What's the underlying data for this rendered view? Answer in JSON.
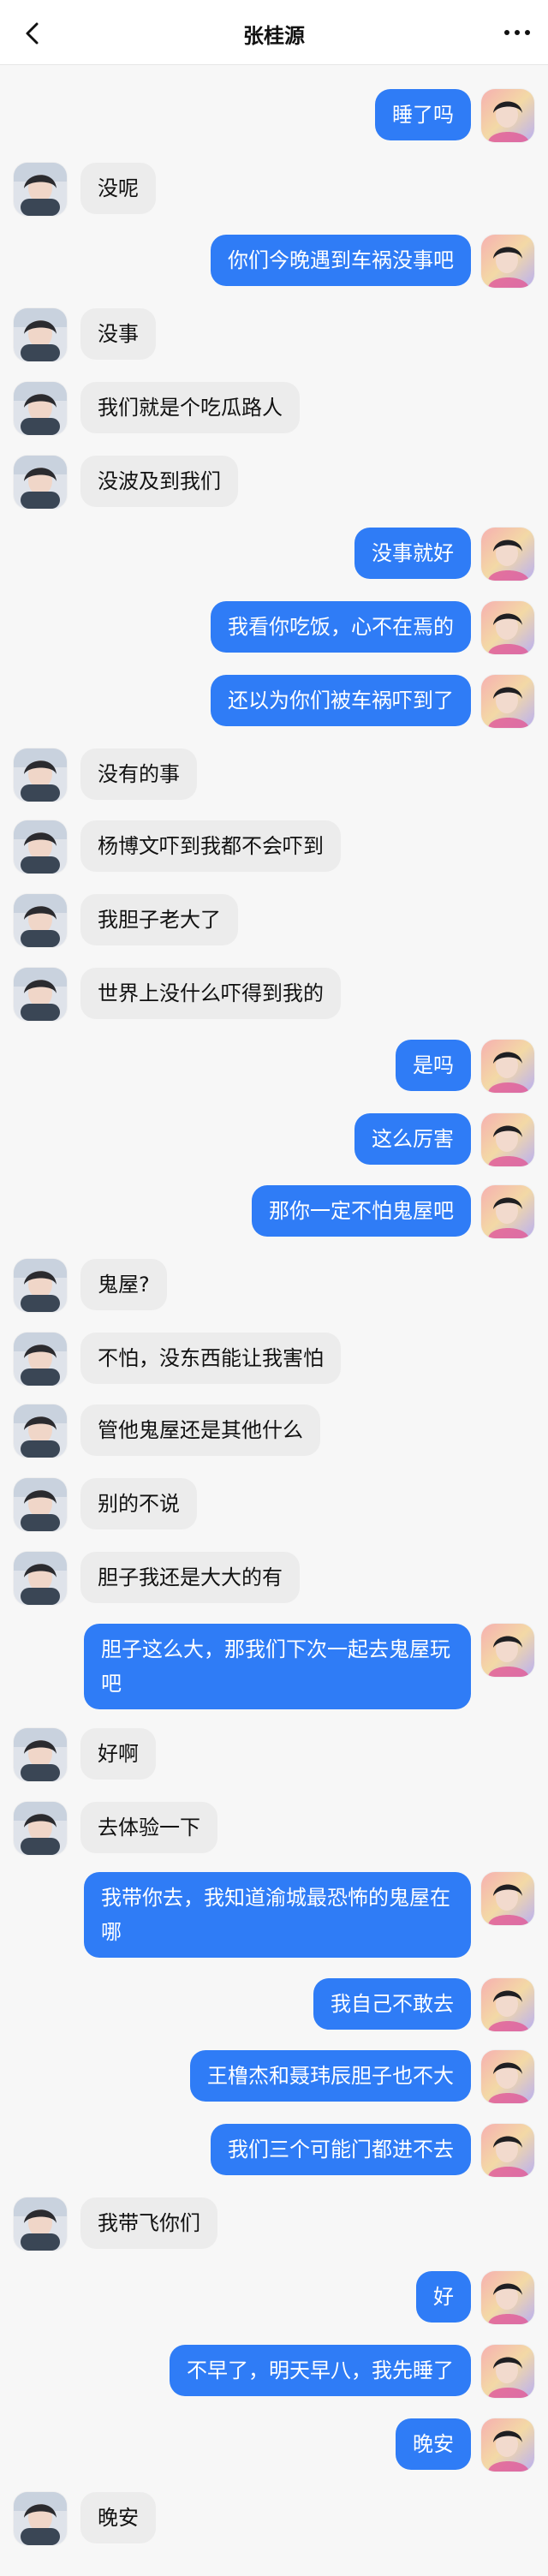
{
  "header": {
    "title": "张桂源"
  },
  "colors": {
    "sent_bubble": "#2f7cf6",
    "received_bubble": "#ececec",
    "background": "#f7f7f7"
  },
  "messages": [
    {
      "side": "right",
      "text": "睡了吗"
    },
    {
      "side": "left",
      "text": "没呢"
    },
    {
      "side": "right",
      "text": "你们今晚遇到车祸没事吧"
    },
    {
      "side": "left",
      "text": "没事"
    },
    {
      "side": "left",
      "text": "我们就是个吃瓜路人"
    },
    {
      "side": "left",
      "text": "没波及到我们"
    },
    {
      "side": "right",
      "text": "没事就好"
    },
    {
      "side": "right",
      "text": "我看你吃饭，心不在焉的"
    },
    {
      "side": "right",
      "text": "还以为你们被车祸吓到了"
    },
    {
      "side": "left",
      "text": "没有的事"
    },
    {
      "side": "left",
      "text": "杨博文吓到我都不会吓到"
    },
    {
      "side": "left",
      "text": "我胆子老大了"
    },
    {
      "side": "left",
      "text": "世界上没什么吓得到我的"
    },
    {
      "side": "right",
      "text": "是吗"
    },
    {
      "side": "right",
      "text": "这么厉害"
    },
    {
      "side": "right",
      "text": "那你一定不怕鬼屋吧"
    },
    {
      "side": "left",
      "text": "鬼屋?"
    },
    {
      "side": "left",
      "text": "不怕，没东西能让我害怕"
    },
    {
      "side": "left",
      "text": "管他鬼屋还是其他什么"
    },
    {
      "side": "left",
      "text": "别的不说"
    },
    {
      "side": "left",
      "text": "胆子我还是大大的有"
    },
    {
      "side": "right",
      "text": "胆子这么大，那我们下次一起去鬼屋玩吧"
    },
    {
      "side": "left",
      "text": "好啊"
    },
    {
      "side": "left",
      "text": "去体验一下"
    },
    {
      "side": "right",
      "text": "我带你去，我知道渝城最恐怖的鬼屋在哪"
    },
    {
      "side": "right",
      "text": "我自己不敢去"
    },
    {
      "side": "right",
      "text": "王橹杰和聂玮辰胆子也不大"
    },
    {
      "side": "right",
      "text": "我们三个可能门都进不去"
    },
    {
      "side": "left",
      "text": "我带飞你们"
    },
    {
      "side": "right",
      "text": "好"
    },
    {
      "side": "right",
      "text": "不早了，明天早八，我先睡了"
    },
    {
      "side": "right",
      "text": "晚安"
    },
    {
      "side": "left",
      "text": "晚安"
    }
  ]
}
